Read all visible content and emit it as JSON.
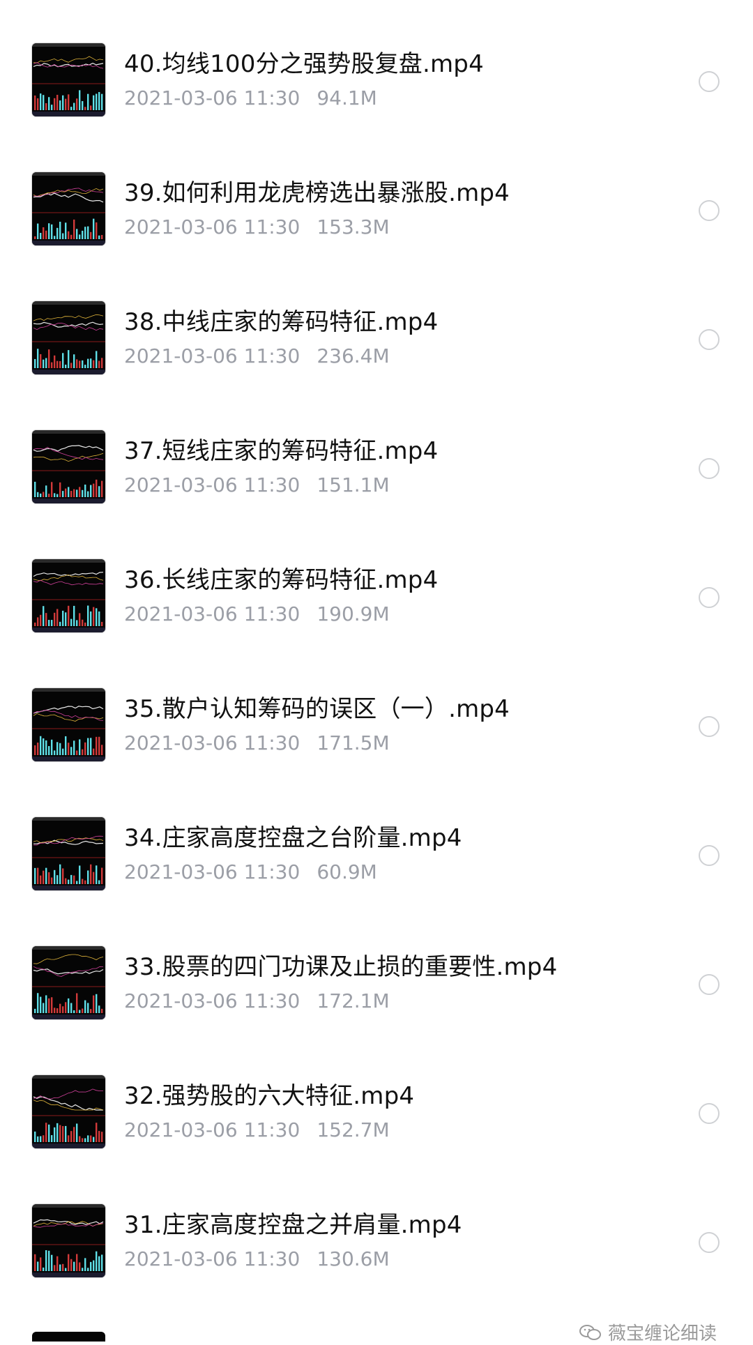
{
  "files": [
    {
      "title": "40.均线100分之强势股复盘.mp4",
      "date": "2021-03-06 11:30",
      "size": "94.1M"
    },
    {
      "title": "39.如何利用龙虎榜选出暴涨股.mp4",
      "date": "2021-03-06 11:30",
      "size": "153.3M"
    },
    {
      "title": "38.中线庄家的筹码特征.mp4",
      "date": "2021-03-06 11:30",
      "size": "236.4M"
    },
    {
      "title": "37.短线庄家的筹码特征.mp4",
      "date": "2021-03-06 11:30",
      "size": "151.1M"
    },
    {
      "title": "36.长线庄家的筹码特征.mp4",
      "date": "2021-03-06 11:30",
      "size": "190.9M"
    },
    {
      "title": "35.散户认知筹码的误区（一）.mp4",
      "date": "2021-03-06 11:30",
      "size": "171.5M"
    },
    {
      "title": "34.庄家高度控盘之台阶量.mp4",
      "date": "2021-03-06 11:30",
      "size": "60.9M"
    },
    {
      "title": "33.股票的四门功课及止损的重要性.mp4",
      "date": "2021-03-06 11:30",
      "size": "172.1M"
    },
    {
      "title": "32.强势股的六大特征.mp4",
      "date": "2021-03-06 11:30",
      "size": "152.7M"
    },
    {
      "title": "31.庄家高度控盘之并肩量.mp4",
      "date": "2021-03-06 11:30",
      "size": "130.6M"
    }
  ],
  "watermark": {
    "text": "薇宝缠论细读",
    "icon": "wechat-icon"
  },
  "colors": {
    "title": "#111111",
    "meta": "#9b9ea6",
    "radio_border": "#cfd1d4",
    "thumb_bg": "#050505"
  }
}
